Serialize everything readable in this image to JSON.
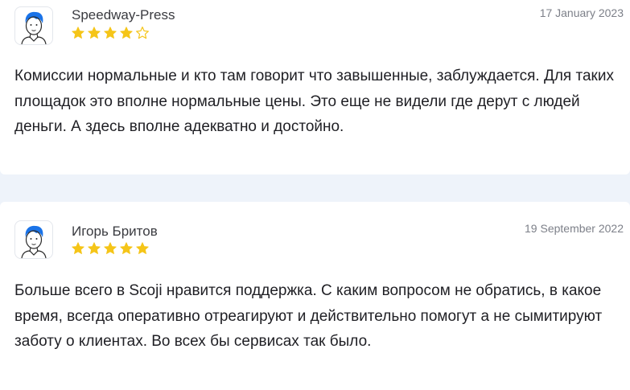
{
  "colors": {
    "star_filled": "#f5c518",
    "star_empty": "#f5c518",
    "page_background": "#eef3fa",
    "card_background": "#ffffff",
    "avatar_hair": "#1a73e8"
  },
  "reviews": [
    {
      "author": "Speedway-Press",
      "date": "17 January 2023",
      "rating": 4,
      "max_rating": 5,
      "avatar_icon": "cartoon-person-icon",
      "text": "Комиссии нормальные и кто там говорит что завышенные, заблуждается. Для таких площадок это вполне нормальные цены. Это еще не видели где дерут с людей деньги. А здесь вполне адекватно и достойно."
    },
    {
      "author": "Игорь Бритов",
      "date": "19 September 2022",
      "rating": 5,
      "max_rating": 5,
      "avatar_icon": "cartoon-person-icon",
      "text": "Больше всего в Scoji нравится поддержка. С каким вопросом не обратись, в какое время, всегда оперативно отреагируют и действительно помогут а не сымитируют заботу о клиентах. Во всех бы сервисах так было."
    }
  ]
}
